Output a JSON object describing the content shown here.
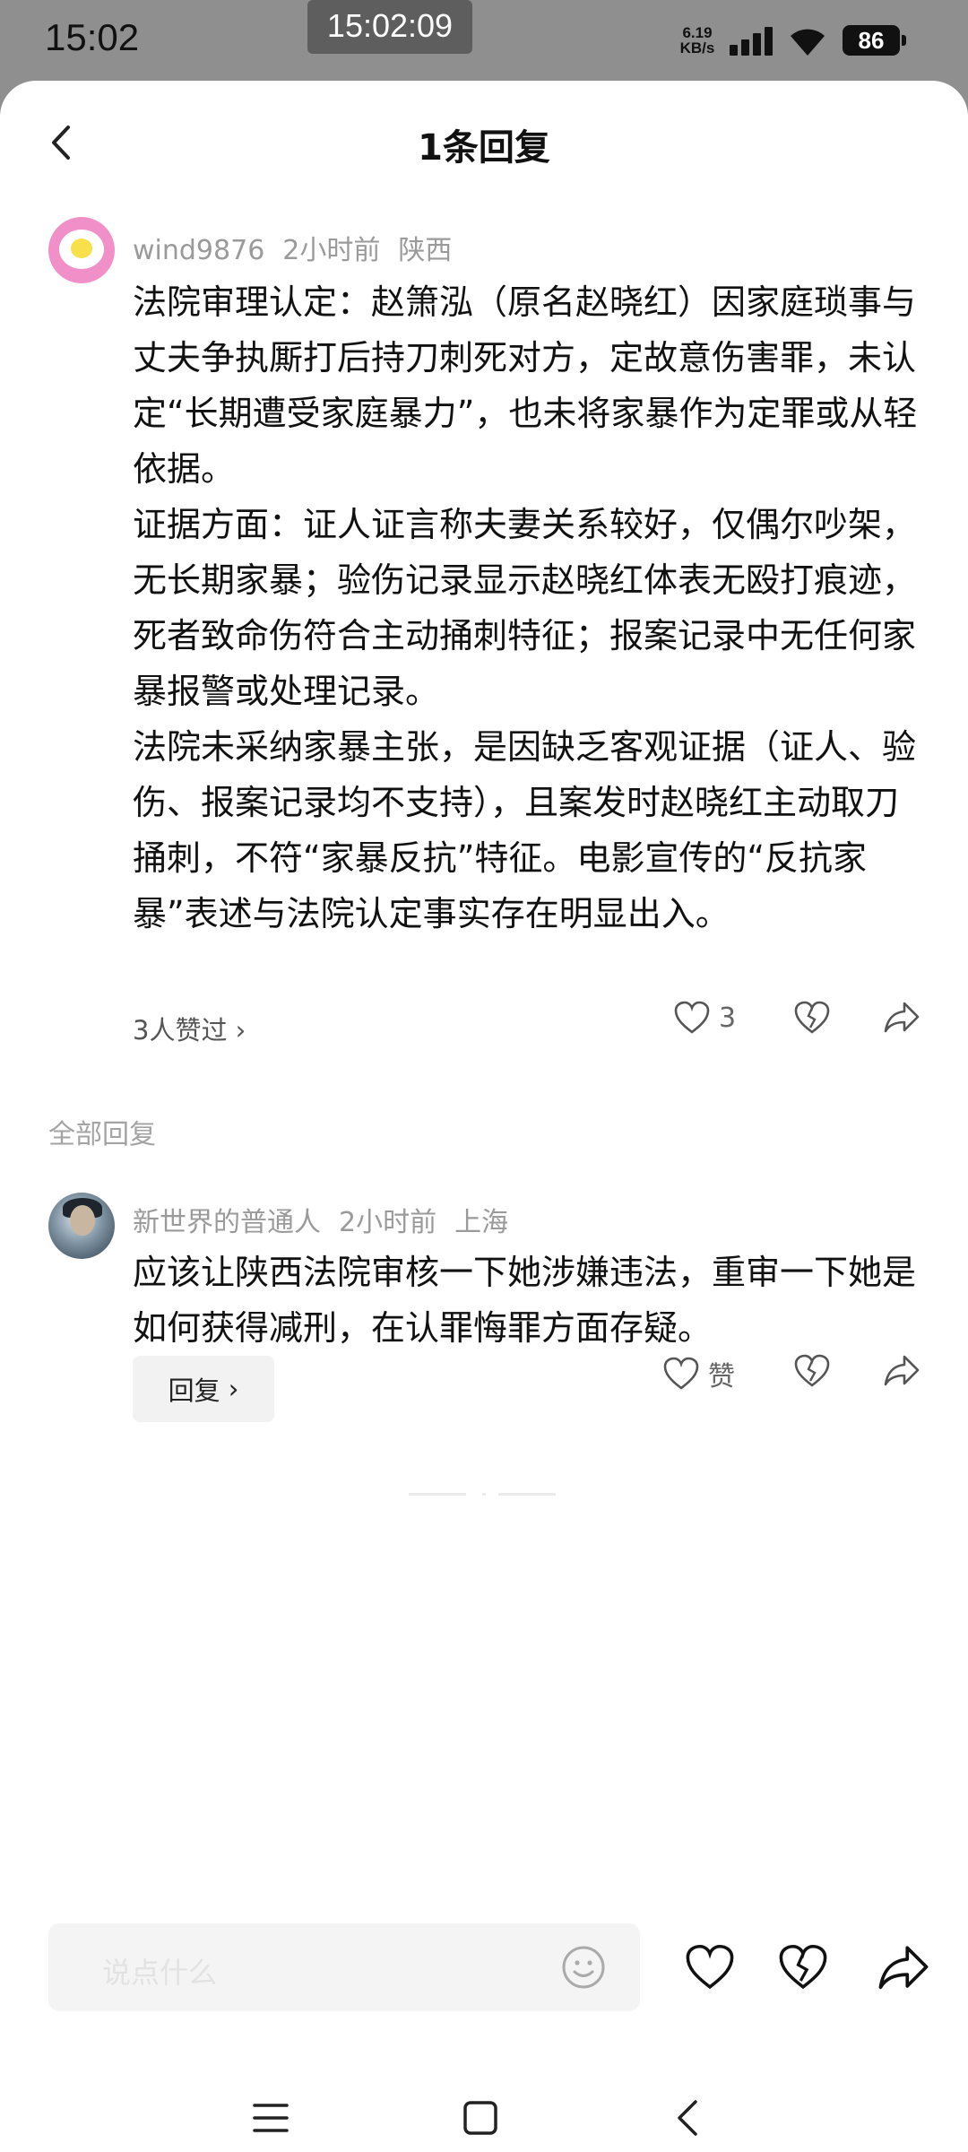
{
  "status_bar": {
    "time": "15:02",
    "clock": "15:02:09",
    "net_speed_value": "6.19",
    "net_speed_unit": "KB/s",
    "battery": "86"
  },
  "header": {
    "title": "1条回复"
  },
  "main_comment": {
    "user": "wind9876",
    "time": "2小时前",
    "location": "陕西",
    "text": "法院审理认定：赵箫泓（原名赵晓红）因家庭琐事与丈夫争执厮打后持刀刺死对方，定故意伤害罪，未认定“长期遭受家庭暴力”，也未将家暴作为定罪或从轻依据。\n证据方面：证人证言称夫妻关系较好，仅偶尔吵架，无长期家暴；验伤记录显示赵晓红体表无殴打痕迹，死者致命伤符合主动捅刺特征；报案记录中无任何家暴报警或处理记录。\n法院未采纳家暴主张，是因缺乏客观证据（证人、验伤、报案记录均不支持），且案发时赵晓红主动取刀捅刺，不符“家暴反抗”特征。电影宣传的“反抗家暴”表述与法院认定事实存在明显出入。",
    "likes_summary": "3人赞过",
    "like_count": "3"
  },
  "section_label": "全部回复",
  "reply": {
    "user": "新世界的普通人",
    "time": "2小时前",
    "location": "上海",
    "text": "应该让陕西法院审核一下她涉嫌违法，重审一下她是如何获得减刑，在认罪悔罪方面存疑。",
    "reply_button": "回复",
    "like_label": "赞"
  },
  "input": {
    "placeholder": "说点什么"
  }
}
